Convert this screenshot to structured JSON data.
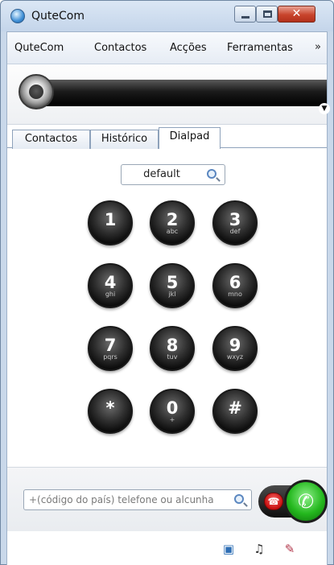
{
  "window": {
    "title": "QuteCom"
  },
  "menu": {
    "items": [
      "QuteCom",
      "Contactos",
      "Acções",
      "Ferramentas"
    ],
    "overflow": "»"
  },
  "tabs": {
    "contacts": "Contactos",
    "history": "Histórico",
    "dialpad": "Dialpad",
    "active": "dialpad"
  },
  "profile": {
    "value": "default",
    "icon": "magnifier-icon"
  },
  "dialpad": {
    "keys": [
      {
        "digit": "1",
        "letters": ""
      },
      {
        "digit": "2",
        "letters": "abc"
      },
      {
        "digit": "3",
        "letters": "def"
      },
      {
        "digit": "4",
        "letters": "ghi"
      },
      {
        "digit": "5",
        "letters": "jkl"
      },
      {
        "digit": "6",
        "letters": "mno"
      },
      {
        "digit": "7",
        "letters": "pqrs"
      },
      {
        "digit": "8",
        "letters": "tuv"
      },
      {
        "digit": "9",
        "letters": "wxyz"
      },
      {
        "digit": "*",
        "letters": ""
      },
      {
        "digit": "0",
        "letters": "+"
      },
      {
        "digit": "#",
        "letters": ""
      }
    ]
  },
  "call": {
    "input_placeholder": "+(código do país) telefone ou alcunha",
    "input_value": "",
    "hangup_icon": "hangup-phone-icon",
    "call_icon": "call-phone-icon"
  },
  "footer": {
    "icons": [
      "network-status-icon",
      "headset-icon",
      "microphone-muted-icon"
    ]
  },
  "colors": {
    "call_green": "#24b81e",
    "hangup_red": "#c40f0f",
    "key_dark": "#1a1a1a"
  }
}
